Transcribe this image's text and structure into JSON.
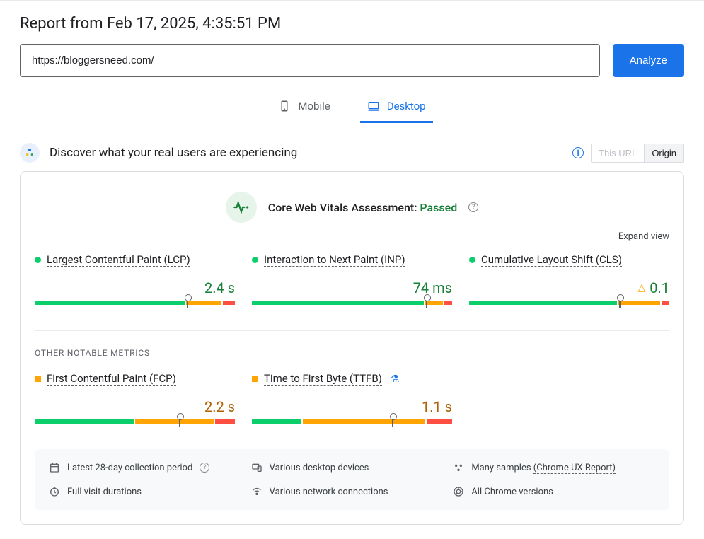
{
  "report_title": "Report from Feb 17, 2025, 4:35:51 PM",
  "url_value": "https://bloggersneed.com/",
  "analyze_label": "Analyze",
  "tabs": {
    "mobile": "Mobile",
    "desktop": "Desktop"
  },
  "discover": {
    "text": "Discover what your real users are experiencing",
    "this_url": "This URL",
    "origin": "Origin"
  },
  "cwv": {
    "prefix": "Core Web Vitals Assessment: ",
    "status": "Passed"
  },
  "expand_label": "Expand view",
  "metrics": {
    "lcp": {
      "name": "Largest Contentful Paint (LCP)",
      "value": "2.4 s"
    },
    "inp": {
      "name": "Interaction to Next Paint (INP)",
      "value": "74 ms"
    },
    "cls": {
      "name": "Cumulative Layout Shift (CLS)",
      "value": "0.1"
    },
    "fcp": {
      "name": "First Contentful Paint (FCP)",
      "value": "2.2 s"
    },
    "ttfb": {
      "name": "Time to First Byte (TTFB)",
      "value": "1.1 s"
    }
  },
  "other_label": "OTHER NOTABLE METRICS",
  "footer": {
    "period": "Latest 28-day collection period",
    "devices": "Various desktop devices",
    "samples_prefix": "Many samples ",
    "samples_link": "(Chrome UX Report)",
    "durations": "Full visit durations",
    "network": "Various network connections",
    "versions": "All Chrome versions"
  }
}
